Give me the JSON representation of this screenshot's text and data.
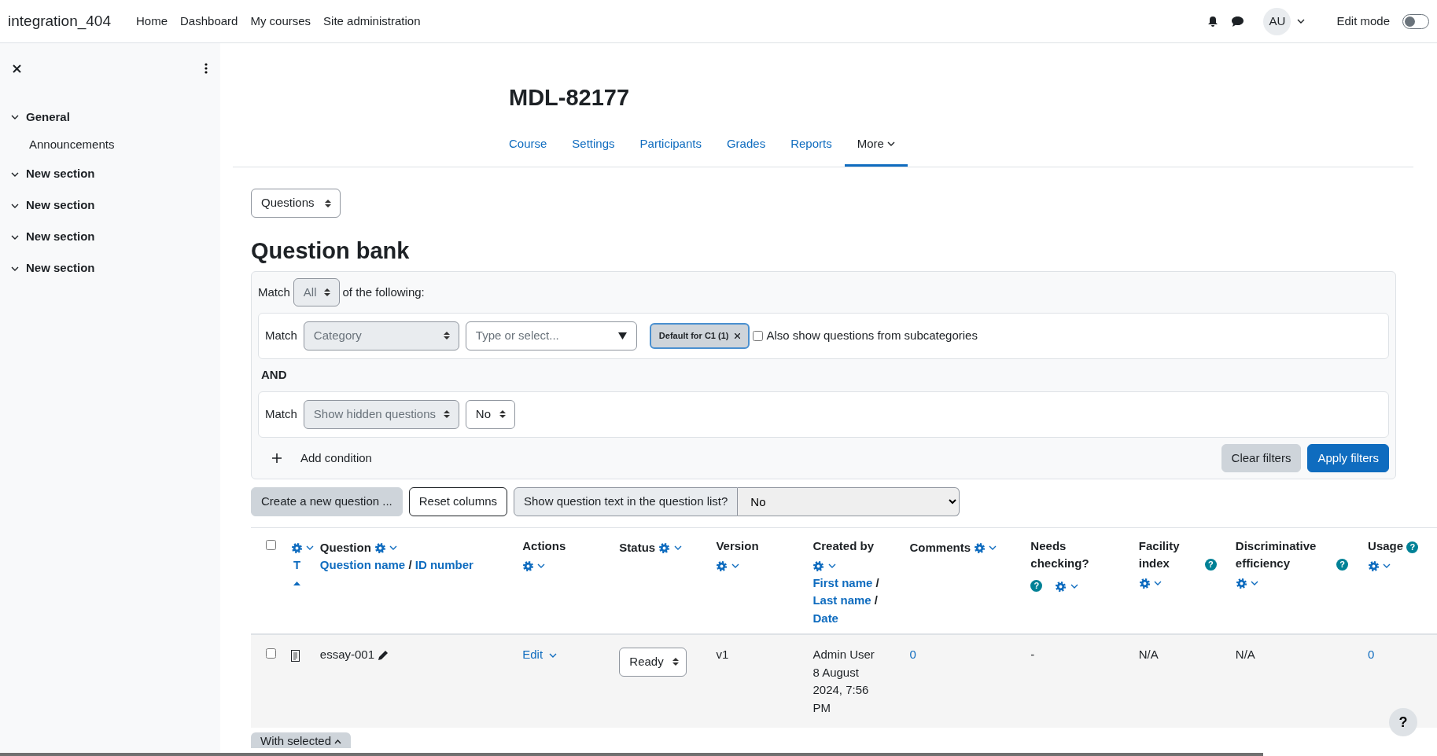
{
  "navbar": {
    "brand": "integration_404",
    "links": [
      "Home",
      "Dashboard",
      "My courses",
      "Site administration"
    ],
    "avatar": "AU",
    "edit_mode": {
      "label": "Edit mode",
      "on": false
    }
  },
  "drawer": {
    "sections": [
      {
        "title": "General",
        "expanded": true,
        "children": [
          {
            "title": "Announcements"
          }
        ]
      },
      {
        "title": "New section",
        "expanded": true
      },
      {
        "title": "New section",
        "expanded": true
      },
      {
        "title": "New section",
        "expanded": true
      },
      {
        "title": "New section",
        "expanded": true
      }
    ]
  },
  "course": {
    "title": "MDL-82177",
    "tabs": [
      {
        "label": "Course",
        "selected": false,
        "kind": "link"
      },
      {
        "label": "Settings",
        "selected": false,
        "kind": "link"
      },
      {
        "label": "Participants",
        "selected": false,
        "kind": "link"
      },
      {
        "label": "Grades",
        "selected": false,
        "kind": "link"
      },
      {
        "label": "Reports",
        "selected": false,
        "kind": "link"
      },
      {
        "label": "More",
        "selected": true,
        "kind": "dropdown"
      }
    ]
  },
  "page_select": "Questions",
  "heading": "Question bank",
  "filters": {
    "match_label": "Match",
    "match_value": "All",
    "of_text": "of the following:",
    "conditions": [
      {
        "kind": "category",
        "match_label": "Match",
        "field": "Category",
        "placeholder": "Type or select...",
        "tag": "Default for C1 (1)",
        "checkbox": {
          "label": "Also show questions from subcategories",
          "checked": false
        }
      },
      {
        "kind": "select",
        "match_label": "Match",
        "field": "Show hidden questions",
        "value": "No"
      }
    ],
    "joiner": "AND",
    "add_condition": "Add condition",
    "clear": "Clear filters",
    "apply": "Apply filters"
  },
  "toolbar": {
    "create": "Create a new question ...",
    "reset": "Reset columns",
    "show_text_label": "Show question text in the question list?",
    "show_text_value": "No"
  },
  "table": {
    "columns": [
      {
        "kind": "checkbox",
        "checked": false
      },
      {
        "kind": "type",
        "sort": "T",
        "sorted": true
      },
      {
        "kind": "sortinline",
        "title": "Question",
        "links": [
          "Question name",
          "ID number"
        ],
        "separator": "/"
      },
      {
        "kind": "gearbelow",
        "title": "Actions"
      },
      {
        "kind": "gearinline",
        "title": "Status"
      },
      {
        "kind": "gearbelow",
        "title": "Version"
      },
      {
        "kind": "sortstacked",
        "title": "Created by",
        "links": [
          "First name",
          "Last name",
          "Date"
        ],
        "separator": "/"
      },
      {
        "kind": "gearinline",
        "title": "Comments"
      },
      {
        "kind": "helpbelow",
        "title": "Needs checking?",
        "help": "?"
      },
      {
        "kind": "helpinline",
        "title": "Facility index",
        "help": "?"
      },
      {
        "kind": "helpinline",
        "title": "Discriminative efficiency",
        "help": "?"
      },
      {
        "kind": "helpinline",
        "title": "Usage",
        "help": "?"
      }
    ],
    "rows": [
      {
        "checked": false,
        "question": "essay-001",
        "action": "Edit",
        "status": "Ready",
        "version": "v1",
        "created_by": "Admin User",
        "created_date": "8 August 2024, 7:56 PM",
        "comments": "0",
        "needs_checking": "-",
        "facility": "N/A",
        "discrimination": "N/A",
        "usage": "0"
      }
    ]
  },
  "with_selected": "With selected",
  "help_button": "?"
}
